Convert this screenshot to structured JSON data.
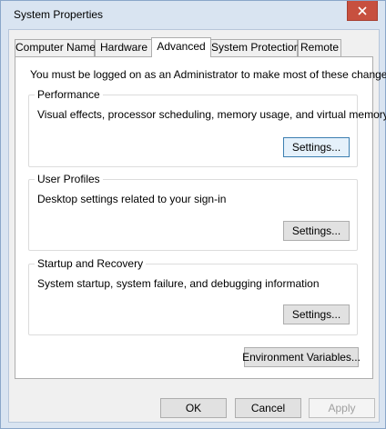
{
  "window": {
    "title": "System Properties",
    "close_symbol": "close-icon"
  },
  "tabs": [
    {
      "label": "Computer Name"
    },
    {
      "label": "Hardware"
    },
    {
      "label": "Advanced"
    },
    {
      "label": "System Protection"
    },
    {
      "label": "Remote"
    }
  ],
  "advanced": {
    "intro": "You must be logged on as an Administrator to make most of these changes.",
    "performance": {
      "title": "Performance",
      "description": "Visual effects, processor scheduling, memory usage, and virtual memory",
      "settings_label": "Settings..."
    },
    "user_profiles": {
      "title": "User Profiles",
      "description": "Desktop settings related to your sign-in",
      "settings_label": "Settings..."
    },
    "startup_recovery": {
      "title": "Startup and Recovery",
      "description": "System startup, system failure, and debugging information",
      "settings_label": "Settings..."
    },
    "env_vars_label": "Environment Variables..."
  },
  "footer": {
    "ok_label": "OK",
    "cancel_label": "Cancel",
    "apply_label": "Apply"
  },
  "colors": {
    "frame": "#d9e4f1",
    "close_button": "#c7503f",
    "focus_border": "#3c7fb1"
  }
}
